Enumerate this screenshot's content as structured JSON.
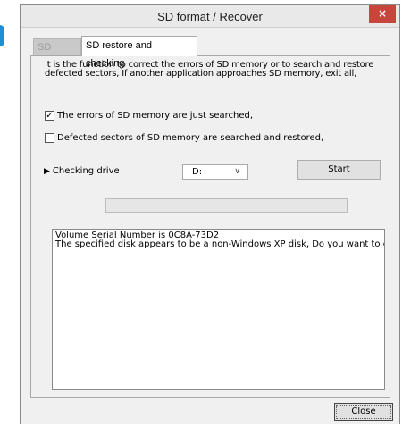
{
  "window": {
    "title": "SD format / Recover",
    "close_glyph": "×"
  },
  "tabs": [
    {
      "label": "SD format",
      "active": false
    },
    {
      "label": "SD restore and checking",
      "active": true
    }
  ],
  "description": {
    "line1": "It is the function to correct the errors of SD memory or to search and restore",
    "line2": "defected sectors,  If another application approaches SD memory, exit all,"
  },
  "options": [
    {
      "label": "The errors of SD memory are just searched,",
      "checked": true
    },
    {
      "label": "Defected sectors of SD memory are searched and restored,",
      "checked": false
    }
  ],
  "drive": {
    "label": "Checking drive",
    "selected": "D:"
  },
  "buttons": {
    "start": "Start",
    "close": "Close"
  },
  "progress": {
    "value": 0
  },
  "log": {
    "lines": [
      "Volume Serial Number is 0C8A-73D2",
      "The specified disk appears to be a non-Windows XP disk,  Do you want to co"
    ]
  },
  "colors": {
    "accent": "#1e8fd6",
    "close_button": "#c7463c"
  }
}
